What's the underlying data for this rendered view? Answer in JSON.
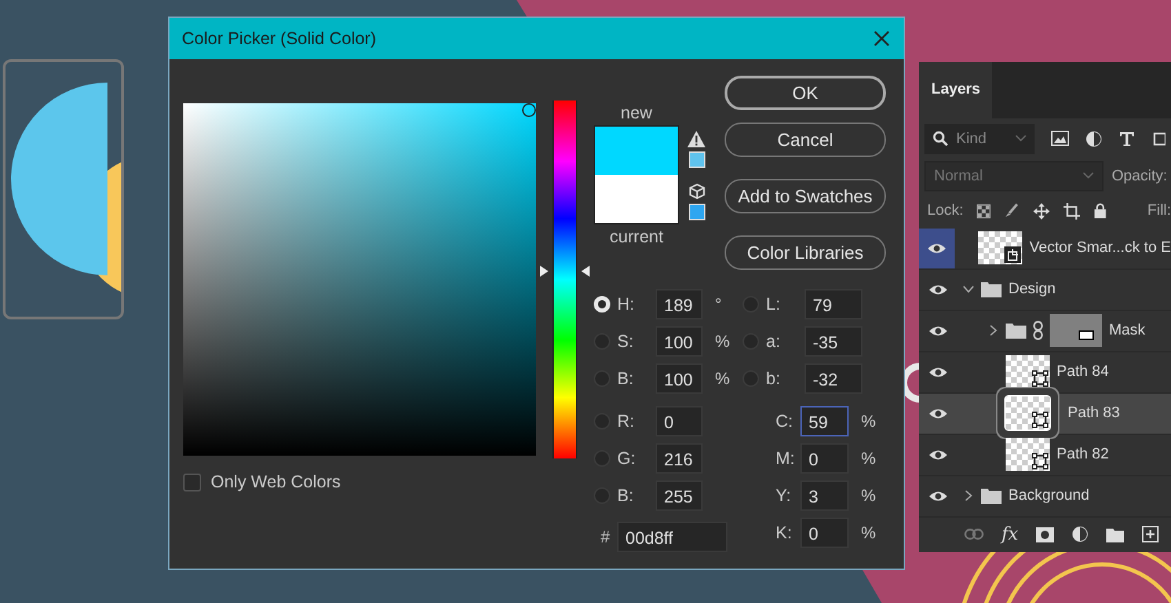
{
  "dialog": {
    "title": "Color Picker (Solid Color)",
    "hue_slider": {
      "level": 0.525
    },
    "swatches": [
      {
        "label": "new",
        "color": "#00d8ff"
      },
      {
        "label": "current",
        "color": "#ffffff"
      }
    ],
    "buttons": [
      {
        "label": "OK",
        "default": true
      },
      {
        "label": "Cancel",
        "default": false
      },
      {
        "label": "Add to Swatches",
        "default": false
      },
      {
        "label": "Color Libraries",
        "default": false
      }
    ],
    "hsb": [
      {
        "label": "H:",
        "value": "189",
        "unit": "°",
        "selected": true
      },
      {
        "label": "S:",
        "value": "100",
        "unit": "%",
        "selected": false
      },
      {
        "label": "B:",
        "value": "100",
        "unit": "%",
        "selected": false
      }
    ],
    "rgb": [
      {
        "label": "R:",
        "value": "0",
        "selected": false
      },
      {
        "label": "G:",
        "value": "216",
        "selected": false
      },
      {
        "label": "B:",
        "value": "255",
        "selected": false
      }
    ],
    "lab": [
      {
        "label": "L:",
        "value": "79",
        "selected": false
      },
      {
        "label": "a:",
        "value": "-35",
        "selected": false
      },
      {
        "label": "b:",
        "value": "-32",
        "selected": false
      }
    ],
    "cmyk": [
      {
        "label": "C:",
        "value": "59",
        "unit": "%",
        "focused": true
      },
      {
        "label": "M:",
        "value": "0",
        "unit": "%",
        "focused": false
      },
      {
        "label": "Y:",
        "value": "3",
        "unit": "%",
        "focused": false
      },
      {
        "label": "K:",
        "value": "0",
        "unit": "%",
        "focused": false
      }
    ],
    "hex": {
      "label": "#",
      "value": "00d8ff"
    },
    "only_web_colors": {
      "label": "Only Web Colors",
      "checked": false
    }
  },
  "layers_panel": {
    "tab": "Layers",
    "filter": "Kind",
    "blend_mode": "Normal",
    "opacity_label": "Opacity:",
    "lock_label": "Lock:",
    "fill_label": "Fill:",
    "footer_fx": "fx",
    "layers": [
      {
        "kind": "smart_object",
        "name": "Vector Smar...ck to E",
        "visible": true,
        "eye_highlighted": true,
        "selected": false
      },
      {
        "kind": "group",
        "name": "Design",
        "visible": true,
        "eye_highlighted": false,
        "selected": false,
        "expanded": true,
        "children": [
          {
            "kind": "masked_group",
            "name": "Mask",
            "visible": true,
            "eye_highlighted": false,
            "selected": false,
            "expanded": false
          },
          {
            "kind": "path",
            "name": "Path 84",
            "visible": true,
            "eye_highlighted": false,
            "selected": false
          },
          {
            "kind": "path",
            "name": "Path 83",
            "visible": true,
            "eye_highlighted": false,
            "selected": true
          },
          {
            "kind": "path",
            "name": "Path 82",
            "visible": true,
            "eye_highlighted": false,
            "selected": false
          }
        ]
      },
      {
        "kind": "group",
        "name": "Background",
        "visible": true,
        "eye_highlighted": false,
        "selected": false,
        "expanded": false
      }
    ]
  }
}
